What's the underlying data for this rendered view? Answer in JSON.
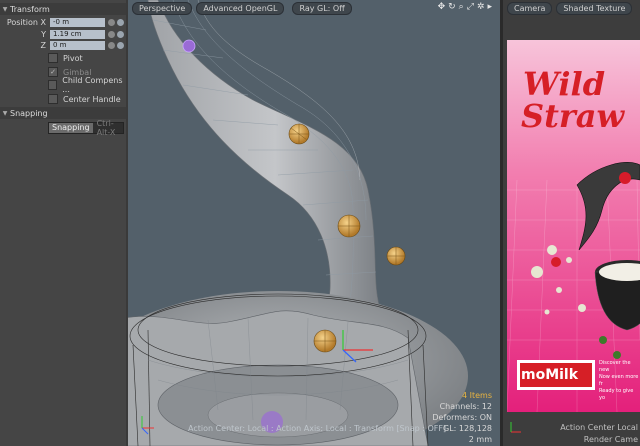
{
  "panel": {
    "transform": {
      "title": "Transform"
    },
    "position": [
      {
        "label": "Position X",
        "value": "-0 m"
      },
      {
        "label": "Y",
        "value": "1.19 cm"
      },
      {
        "label": "Z",
        "value": "0 m"
      }
    ],
    "checks": [
      {
        "label": "Pivot",
        "checked": false,
        "enabled": true
      },
      {
        "label": "Gimbal",
        "checked": true,
        "enabled": false
      },
      {
        "label": "Child Compens ...",
        "checked": false,
        "enabled": true
      },
      {
        "label": "Center Handle",
        "checked": false,
        "enabled": true
      }
    ],
    "snapping": {
      "title": "Snapping",
      "button": "Snapping",
      "shortcut": "Ctrl-Alt-X"
    }
  },
  "viewport_left": {
    "tabs": [
      "Perspective",
      "Advanced OpenGL",
      "Ray GL: Off"
    ],
    "stats": {
      "items": "4 Items",
      "channels": "Channels: 12",
      "deformers": "Deformers: ON",
      "gl": "GL: 128,128",
      "scale": "2 mm"
    },
    "status": "Action Center: Local : Action Axis: Local : Transform [Snap : OFF]"
  },
  "viewport_right": {
    "tabs": [
      "Camera",
      "Shaded Texture"
    ],
    "title_line1": "Wild",
    "title_line2": "Straw",
    "brand": "moMilk",
    "copy": [
      "Discover the new",
      "Now even more fr",
      "Ready to give yo"
    ],
    "status_line1": "Action Center Local",
    "status_line2": "Render Came"
  },
  "colors": {
    "panel_bg": "#454545",
    "viewport_bg": "#53606a",
    "selection": "#e9b441",
    "render_bg": "#f05a98",
    "brand_red": "#d61f26"
  },
  "icons": [
    "move-icon",
    "rotate-icon",
    "zoom-icon",
    "fit-icon",
    "settings-icon",
    "play-icon"
  ]
}
